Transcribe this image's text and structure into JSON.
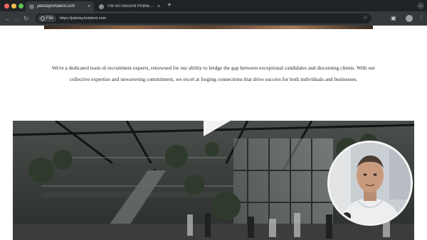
{
  "browser": {
    "tabs": [
      {
        "label": "jaketaylortalent.com",
        "active": true
      },
      {
        "label": "The 60-Second Problem — L",
        "active": false
      }
    ],
    "new_tab_label": "+",
    "omnibox": {
      "chip": "File",
      "url": "https://jaketaylortalent.com"
    }
  },
  "page": {
    "intro_text": "We're a dedicated team of recruitment experts, renowned for our ability to bridge the gap between exceptional candidates and discerning clients. With our collective expertise and unwavering commitment, we excel at forging connections that drive success for both individuals and businesses."
  },
  "icons": {
    "back": "arrow-left-icon",
    "forward": "arrow-right-icon",
    "reload": "reload-icon",
    "bookmark": "star-icon",
    "extensions": "puzzle-icon",
    "menu": "kebab-icon"
  }
}
